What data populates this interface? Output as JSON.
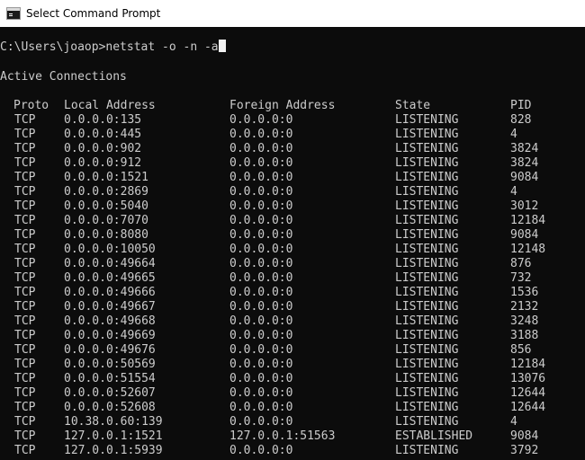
{
  "window": {
    "title": "Select Command Prompt",
    "icon": "console-icon"
  },
  "console": {
    "command_line": "C:\\Users\\joaop>netstat -o -n -a",
    "section_title": "Active Connections",
    "headers": {
      "proto": "Proto",
      "local": "Local Address",
      "foreign": "Foreign Address",
      "state": "State",
      "pid": "PID"
    },
    "rows": [
      {
        "proto": "TCP",
        "local": "0.0.0.0:135",
        "foreign": "0.0.0.0:0",
        "state": "LISTENING",
        "pid": "828"
      },
      {
        "proto": "TCP",
        "local": "0.0.0.0:445",
        "foreign": "0.0.0.0:0",
        "state": "LISTENING",
        "pid": "4"
      },
      {
        "proto": "TCP",
        "local": "0.0.0.0:902",
        "foreign": "0.0.0.0:0",
        "state": "LISTENING",
        "pid": "3824"
      },
      {
        "proto": "TCP",
        "local": "0.0.0.0:912",
        "foreign": "0.0.0.0:0",
        "state": "LISTENING",
        "pid": "3824"
      },
      {
        "proto": "TCP",
        "local": "0.0.0.0:1521",
        "foreign": "0.0.0.0:0",
        "state": "LISTENING",
        "pid": "9084"
      },
      {
        "proto": "TCP",
        "local": "0.0.0.0:2869",
        "foreign": "0.0.0.0:0",
        "state": "LISTENING",
        "pid": "4"
      },
      {
        "proto": "TCP",
        "local": "0.0.0.0:5040",
        "foreign": "0.0.0.0:0",
        "state": "LISTENING",
        "pid": "3012"
      },
      {
        "proto": "TCP",
        "local": "0.0.0.0:7070",
        "foreign": "0.0.0.0:0",
        "state": "LISTENING",
        "pid": "12184"
      },
      {
        "proto": "TCP",
        "local": "0.0.0.0:8080",
        "foreign": "0.0.0.0:0",
        "state": "LISTENING",
        "pid": "9084"
      },
      {
        "proto": "TCP",
        "local": "0.0.0.0:10050",
        "foreign": "0.0.0.0:0",
        "state": "LISTENING",
        "pid": "12148"
      },
      {
        "proto": "TCP",
        "local": "0.0.0.0:49664",
        "foreign": "0.0.0.0:0",
        "state": "LISTENING",
        "pid": "876"
      },
      {
        "proto": "TCP",
        "local": "0.0.0.0:49665",
        "foreign": "0.0.0.0:0",
        "state": "LISTENING",
        "pid": "732"
      },
      {
        "proto": "TCP",
        "local": "0.0.0.0:49666",
        "foreign": "0.0.0.0:0",
        "state": "LISTENING",
        "pid": "1536"
      },
      {
        "proto": "TCP",
        "local": "0.0.0.0:49667",
        "foreign": "0.0.0.0:0",
        "state": "LISTENING",
        "pid": "2132"
      },
      {
        "proto": "TCP",
        "local": "0.0.0.0:49668",
        "foreign": "0.0.0.0:0",
        "state": "LISTENING",
        "pid": "3248"
      },
      {
        "proto": "TCP",
        "local": "0.0.0.0:49669",
        "foreign": "0.0.0.0:0",
        "state": "LISTENING",
        "pid": "3188"
      },
      {
        "proto": "TCP",
        "local": "0.0.0.0:49676",
        "foreign": "0.0.0.0:0",
        "state": "LISTENING",
        "pid": "856"
      },
      {
        "proto": "TCP",
        "local": "0.0.0.0:50569",
        "foreign": "0.0.0.0:0",
        "state": "LISTENING",
        "pid": "12184"
      },
      {
        "proto": "TCP",
        "local": "0.0.0.0:51554",
        "foreign": "0.0.0.0:0",
        "state": "LISTENING",
        "pid": "13076"
      },
      {
        "proto": "TCP",
        "local": "0.0.0.0:52607",
        "foreign": "0.0.0.0:0",
        "state": "LISTENING",
        "pid": "12644"
      },
      {
        "proto": "TCP",
        "local": "0.0.0.0:52608",
        "foreign": "0.0.0.0:0",
        "state": "LISTENING",
        "pid": "12644"
      },
      {
        "proto": "TCP",
        "local": "10.38.0.60:139",
        "foreign": "0.0.0.0:0",
        "state": "LISTENING",
        "pid": "4"
      },
      {
        "proto": "TCP",
        "local": "127.0.0.1:1521",
        "foreign": "127.0.0.1:51563",
        "state": "ESTABLISHED",
        "pid": "9084"
      },
      {
        "proto": "TCP",
        "local": "127.0.0.1:5939",
        "foreign": "0.0.0.0:0",
        "state": "LISTENING",
        "pid": "3792"
      }
    ]
  },
  "colors": {
    "console_background": "#0c0c0c",
    "console_text": "#cccccc",
    "titlebar_background": "#ffffff"
  }
}
